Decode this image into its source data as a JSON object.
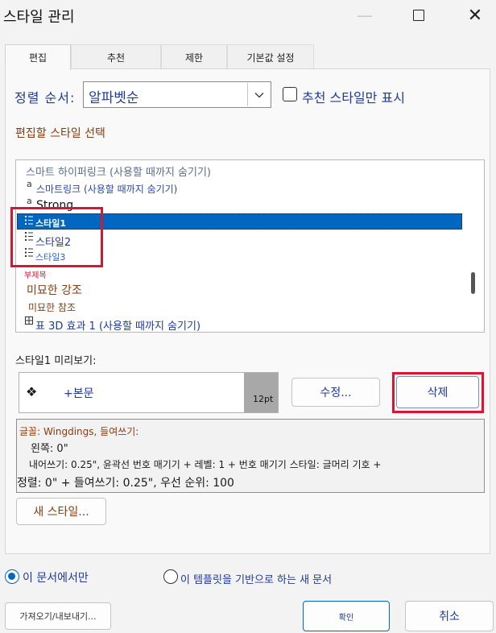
{
  "window": {
    "title": "스타일 관리",
    "controls": {
      "minimize": "—",
      "close": "✕"
    }
  },
  "tabs": [
    {
      "label": "편집",
      "active": true
    },
    {
      "label": "추천",
      "active": false
    },
    {
      "label": "제한",
      "active": false
    },
    {
      "label": "기본값 설정",
      "active": false
    }
  ],
  "sort": {
    "label": "정렬 순서:",
    "value": "알파벳순",
    "dropdown_icon": "chevron-down-icon"
  },
  "recommended_only": {
    "label": "추천 스타일만 표시",
    "checked": false
  },
  "select_section_label": "편집할 스타일 선택",
  "style_list": {
    "items": [
      {
        "label": "스마트 하이퍼링크 (사용할 때까지 숨기기)",
        "glyph": "",
        "color": "#5b6e8c",
        "selected": false
      },
      {
        "label": "스마트링크 (사용할 때까지 숨기기)",
        "glyph": "a",
        "color": "#2b4a9e",
        "selected": false
      },
      {
        "label": "Strong",
        "glyph": "a",
        "color": "#111111",
        "selected": false
      },
      {
        "label": "스타일1",
        "glyph": "list",
        "color": "#ffffff",
        "selected": true
      },
      {
        "label": "스타일2",
        "glyph": "list",
        "color": "#1f3b99",
        "selected": false
      },
      {
        "label": "스타일3",
        "glyph": "list",
        "color": "#2a5bd7",
        "selected": false
      },
      {
        "label": "부제목",
        "glyph": "",
        "color": "#d9162f",
        "selected": false
      },
      {
        "label": "미묘한 강조",
        "glyph": "",
        "color": "#8a3b0e",
        "selected": false
      },
      {
        "label": "미묘한 참조",
        "glyph": "",
        "color": "#8a3b0e",
        "selected": false
      },
      {
        "label": "표 3D 효과 1 (사용할 때까지 숨기기)",
        "glyph": "table",
        "color": "#1f3b99",
        "selected": false
      }
    ]
  },
  "preview": {
    "label": "스타일1 미리보기:",
    "symbol": "❖",
    "text": "+본문",
    "size": "12pt"
  },
  "buttons": {
    "modify": "수정...",
    "delete": "삭제",
    "new_style": "새 스타일...",
    "import_export": "가져오기/내보내기...",
    "ok": "확인",
    "cancel": "취소"
  },
  "description": {
    "line1": "글꼴: Wingdings, 들여쓰기:",
    "line2": "왼쪽: 0\"",
    "line3": "내어쓰기: 0.25\", 윤곽선 번호 매기기 + 레벨: 1 + 번호 매기기 스타일: 글머리 기호 +",
    "line4": "정렬: 0\" + 들여쓰기: 0.25\", 우선 순위: 100"
  },
  "scope": {
    "this_document": "이 문서에서만",
    "new_documents": "이 템플릿을 기반으로 하는 새 문서",
    "selected": "this_document"
  },
  "colors": {
    "accent": "#0067c0",
    "label_blue": "#1f3b99",
    "label_brown": "#8a3b0e",
    "highlight_red": "#d9162f"
  }
}
